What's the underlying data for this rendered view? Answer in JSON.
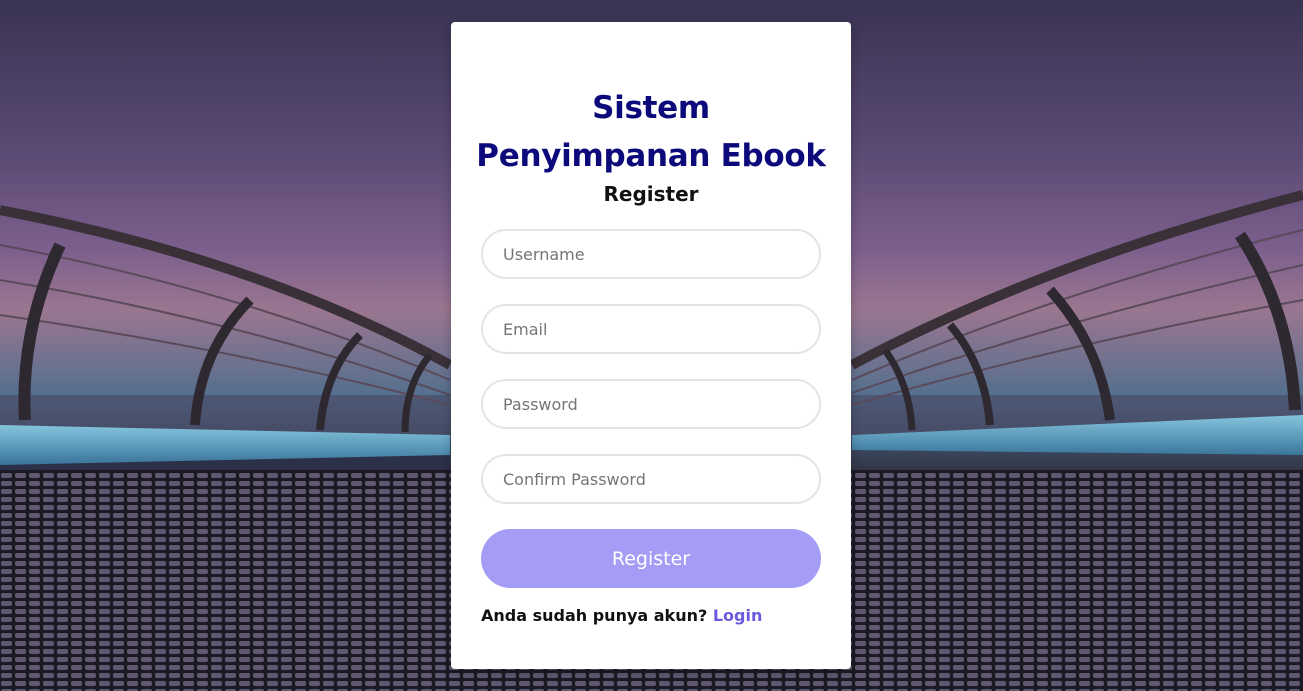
{
  "page": {
    "title_line1": "Sistem",
    "title_line2": "Penyimpanan Ebook",
    "subtitle": "Register"
  },
  "form": {
    "username_placeholder": "Username",
    "email_placeholder": "Email",
    "password_placeholder": "Password",
    "confirm_password_placeholder": "Confirm Password",
    "submit_label": "Register"
  },
  "footer": {
    "prompt": "Anda sudah punya akun?",
    "login_link": "Login"
  },
  "colors": {
    "title": "#0c0a7a",
    "button": "#a49cf5",
    "link": "#6a5ae0"
  }
}
